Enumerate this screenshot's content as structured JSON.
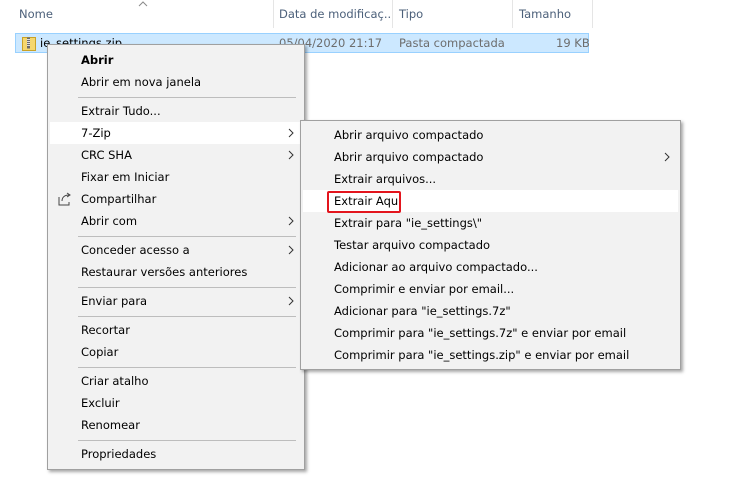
{
  "columns": {
    "name": "Nome",
    "modified": "Data de modificaç...",
    "type": "Tipo",
    "size": "Tamanho"
  },
  "file": {
    "name": "ie_settings.zip",
    "modified": "05/04/2020 21:17",
    "type": "Pasta compactada",
    "size": "19 KB"
  },
  "context_menu": {
    "open": "Abrir",
    "open_new_window": "Abrir em nova janela",
    "extract_all": "Extrair Tudo...",
    "seven_zip": "7-Zip",
    "crc_sha": "CRC SHA",
    "pin_start": "Fixar em Iniciar",
    "share": "Compartilhar",
    "open_with": "Abrir com",
    "grant_access": "Conceder acesso a",
    "restore_versions": "Restaurar versões anteriores",
    "send_to": "Enviar para",
    "cut": "Recortar",
    "copy": "Copiar",
    "create_shortcut": "Criar atalho",
    "delete": "Excluir",
    "rename": "Renomear",
    "properties": "Propriedades"
  },
  "submenu_7zip": {
    "items": [
      "Abrir arquivo compactado",
      "Abrir arquivo compactado",
      "Extrair arquivos...",
      "Extrair Aqui",
      "Extrair para \"ie_settings\\\"",
      "Testar arquivo compactado",
      "Adicionar ao arquivo compactado...",
      "Comprimir e enviar por email...",
      "Adicionar para \"ie_settings.7z\"",
      "Comprimir para \"ie_settings.7z\" e enviar por email",
      "Comprimir para \"ie_settings.zip\" e enviar por email"
    ]
  },
  "colors": {
    "selection_bg": "#cce8ff",
    "highlight_border": "#e3151d",
    "header_text": "#4c607a"
  },
  "icons": [
    "zip-folder-icon",
    "share-icon",
    "chevron-right-icon",
    "sort-up-icon"
  ]
}
